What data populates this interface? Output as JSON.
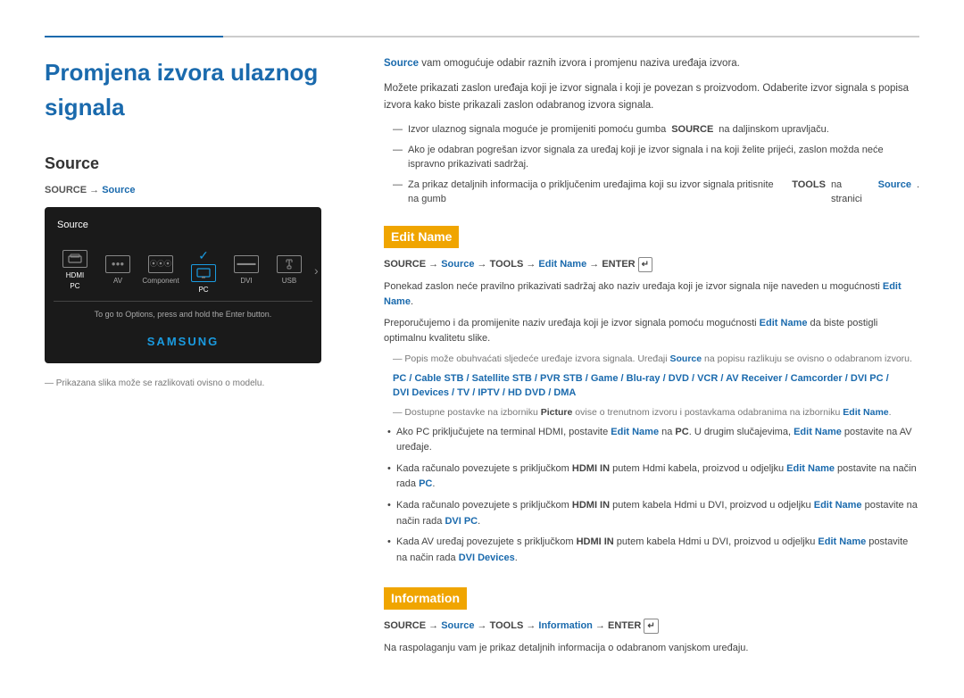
{
  "page": {
    "top_line": true,
    "title": "Promjena izvora ulaznog signala"
  },
  "left": {
    "section_title": "Source",
    "breadcrumb_prefix": "SOURCE → ",
    "breadcrumb_highlight": "Source",
    "tv_screen": {
      "header": "Source",
      "icons": [
        {
          "label": "HDMI\nPC",
          "selected": false
        },
        {
          "label": "AV",
          "selected": false
        },
        {
          "label": "Component",
          "selected": false
        },
        {
          "label": "PC",
          "selected": true
        },
        {
          "label": "DVI",
          "selected": false
        },
        {
          "label": "USB",
          "selected": false
        }
      ],
      "hint": "To go to Options, press and hold the Enter button.",
      "samsung_logo": "SAMSUNG"
    },
    "footnote": "Prikazana slika može se razlikovati ovisno o modelu."
  },
  "right": {
    "intro_bold": "Source",
    "intro1": " vam omogućuje odabir raznih izvora i promjenu naziva uređaja izvora.",
    "intro2": "Možete prikazati zaslon uređaja koji je izvor signala i koji je povezan s proizvodom. Odaberite izvor signala s popisa izvora kako biste prikazali zaslon odabranog izvora signala.",
    "bullets": [
      "Izvor ulaznog signala moguće je promijeniti pomoću gumba SOURCE na daljinskom upravljaču.",
      "Ako je odabran pogrešan izvor signala za uređaj koji je izvor signala i na koji želite prijeći, zaslon možda neće ispravno prikazivati sadržaj.",
      "Za prikaz detaljnih informacija o priključenim uređajima koji su izvor signala pritisnite na gumb TOOLS na stranici Source."
    ],
    "edit_name_section": {
      "heading": "Edit Name",
      "path": "SOURCE → Source → TOOLS → Edit Name → ENTER",
      "path_blue_parts": [
        "Source",
        "Edit Name"
      ],
      "body1": "Ponekad zaslon neće pravilno prikazivati sadržaj ako naziv uređaja koji je izvor signala nije naveden u mogućnosti Edit Name.",
      "body2": "Preporučujemo i da promijenite naziv uređaja koji je izvor signala pomoću mogućnosti Edit Name da biste postigli optimalnu kvalitetu slike.",
      "note": "Popis može obuhvaćati sljedeće uređaje izvora signala. Uređaji Source na popisu razlikuju se ovisno o odabranom izvoru.",
      "source_list": "PC / Cable STB / Satellite STB / PVR STB / Game / Blu-ray / DVD / VCR / AV Receiver / Camcorder / DVI PC / DVI Devices / TV / IPTV / HD DVD / DMA",
      "note2": "Dostupne postavke na izborniku Picture ovise o trenutnom izvoru i postavkama odabranima na izborniku Edit Name.",
      "bullets": [
        {
          "text": "Ako PC priključujete na terminal HDMI, postavite Edit Name na PC. U drugim slučajevima, Edit Name postavite na AV uređaje.",
          "blue_parts": [
            "Edit Name",
            "Edit Name"
          ]
        },
        {
          "text": "Kada računalo povezujete s priključkom HDMI IN putem Hdmi kabela, proizvod u odjeljku Edit Name postavite na način rada PC.",
          "blue_parts": [
            "Edit Name",
            "PC"
          ]
        },
        {
          "text": "Kada računalo povezujete s priključkom HDMI IN putem kabela Hdmi u DVI, proizvod u odjeljku Edit Name postavite na način rada DVI PC.",
          "blue_parts": [
            "Edit Name",
            "DVI PC"
          ]
        },
        {
          "text": "Kada AV uređaj povezujete s priključkom HDMI IN putem kabela Hdmi u DVI, proizvod u odjeljku Edit Name postavite na način rada DVI Devices.",
          "blue_parts": [
            "Edit Name",
            "DVI Devices"
          ]
        }
      ]
    },
    "information_section": {
      "heading": "Information",
      "path": "SOURCE → Source → TOOLS → Information → ENTER",
      "path_blue_parts": [
        "Source",
        "Information"
      ],
      "body": "Na raspolaganju vam je prikaz detaljnih informacija o odabranom vanjskom uređaju."
    }
  }
}
